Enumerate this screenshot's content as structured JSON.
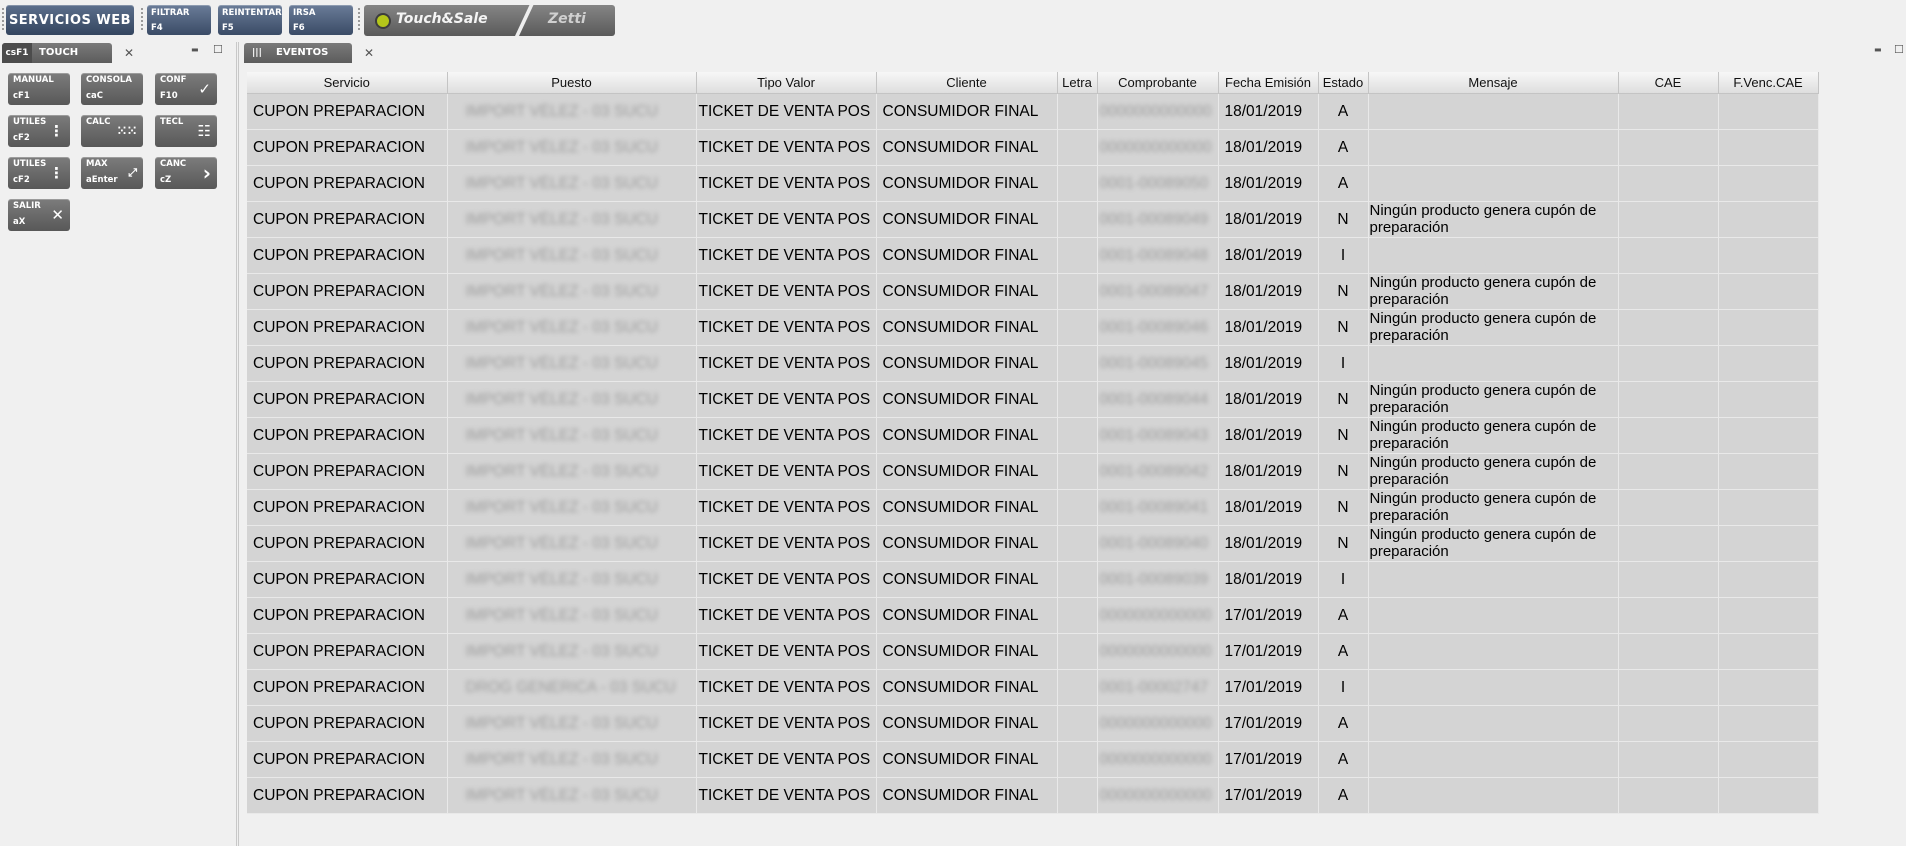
{
  "toolbar": {
    "main_label": "SERVICIOS WEB",
    "buttons": [
      {
        "label": "FILTRAR",
        "shortcut": "F4"
      },
      {
        "label": "REINTENTAR",
        "shortcut": "F5"
      },
      {
        "label": "IRSA",
        "shortcut": "F6"
      }
    ],
    "logo_primary": "Touch&Sale",
    "logo_secondary": "Zetti"
  },
  "left_panel": {
    "tab_prefix": "csF1",
    "tab_label": "TOUCH",
    "close_glyph": "✕",
    "minimize_glyph": "▬",
    "maximize_glyph": "☐",
    "tiles": [
      {
        "label": "MANUAL",
        "shortcut": "cF1",
        "icon": ""
      },
      {
        "label": "CONSOLA",
        "shortcut": "caC",
        "icon": ""
      },
      {
        "label": "CONF",
        "shortcut": "F10",
        "icon": "✓"
      },
      {
        "label": "UTILES",
        "shortcut": "cF2",
        "icon": "⋮"
      },
      {
        "label": "CALC",
        "shortcut": "",
        "icon": "⁙⁙"
      },
      {
        "label": "TECL",
        "shortcut": "",
        "icon": "☷"
      },
      {
        "label": "UTILES",
        "shortcut": "cF2",
        "icon": "⋮"
      },
      {
        "label": "MAX",
        "shortcut": "aEnter",
        "icon": "⤢"
      },
      {
        "label": "CANC",
        "shortcut": "cZ",
        "icon": "›"
      },
      {
        "label": "SALIR",
        "shortcut": "aX",
        "icon": "✕"
      }
    ]
  },
  "right_panel": {
    "tab_bars": "|||",
    "tab_label": "EVENTOS",
    "close_glyph": "✕",
    "minimize_glyph": "▬",
    "maximize_glyph": "☐",
    "columns": [
      "Servicio",
      "Puesto",
      "Tipo Valor",
      "Cliente",
      "Letra",
      "Comprobante",
      "Fecha Emisión",
      "Estado",
      "Mensaje",
      "CAE",
      "F.Venc.CAE"
    ],
    "rows": [
      {
        "servicio": "CUPON PREPARACION",
        "puesto": "IMPORT VÉLEZ - 03 SUCU",
        "tipo": "TICKET DE VENTA POS",
        "cliente": "CONSUMIDOR FINAL",
        "letra": "",
        "comprobante": "0000000000000",
        "fecha": "18/01/2019",
        "estado": "A",
        "mensaje": "",
        "cae": "",
        "fvenc": ""
      },
      {
        "servicio": "CUPON PREPARACION",
        "puesto": "IMPORT VÉLEZ - 03 SUCU",
        "tipo": "TICKET DE VENTA POS",
        "cliente": "CONSUMIDOR FINAL",
        "letra": "",
        "comprobante": "0000000000000",
        "fecha": "18/01/2019",
        "estado": "A",
        "mensaje": "",
        "cae": "",
        "fvenc": ""
      },
      {
        "servicio": "CUPON PREPARACION",
        "puesto": "IMPORT VÉLEZ - 03 SUCU",
        "tipo": "TICKET DE VENTA POS",
        "cliente": "CONSUMIDOR FINAL",
        "letra": "",
        "comprobante": "0001-00089050",
        "fecha": "18/01/2019",
        "estado": "A",
        "mensaje": "",
        "cae": "",
        "fvenc": ""
      },
      {
        "servicio": "CUPON PREPARACION",
        "puesto": "IMPORT VÉLEZ - 03 SUCU",
        "tipo": "TICKET DE VENTA POS",
        "cliente": "CONSUMIDOR FINAL",
        "letra": "",
        "comprobante": "0001-00089049",
        "fecha": "18/01/2019",
        "estado": "N",
        "mensaje": "Ningún producto genera cupón de preparación",
        "cae": "",
        "fvenc": ""
      },
      {
        "servicio": "CUPON PREPARACION",
        "puesto": "IMPORT VÉLEZ - 03 SUCU",
        "tipo": "TICKET DE VENTA POS",
        "cliente": "CONSUMIDOR FINAL",
        "letra": "",
        "comprobante": "0001-00089048",
        "fecha": "18/01/2019",
        "estado": "I",
        "mensaje": "",
        "cae": "",
        "fvenc": ""
      },
      {
        "servicio": "CUPON PREPARACION",
        "puesto": "IMPORT VÉLEZ - 03 SUCU",
        "tipo": "TICKET DE VENTA POS",
        "cliente": "CONSUMIDOR FINAL",
        "letra": "",
        "comprobante": "0001-00089047",
        "fecha": "18/01/2019",
        "estado": "N",
        "mensaje": "Ningún producto genera cupón de preparación",
        "cae": "",
        "fvenc": ""
      },
      {
        "servicio": "CUPON PREPARACION",
        "puesto": "IMPORT VÉLEZ - 03 SUCU",
        "tipo": "TICKET DE VENTA POS",
        "cliente": "CONSUMIDOR FINAL",
        "letra": "",
        "comprobante": "0001-00089046",
        "fecha": "18/01/2019",
        "estado": "N",
        "mensaje": "Ningún producto genera cupón de preparación",
        "cae": "",
        "fvenc": ""
      },
      {
        "servicio": "CUPON PREPARACION",
        "puesto": "IMPORT VÉLEZ - 03 SUCU",
        "tipo": "TICKET DE VENTA POS",
        "cliente": "CONSUMIDOR FINAL",
        "letra": "",
        "comprobante": "0001-00089045",
        "fecha": "18/01/2019",
        "estado": "I",
        "mensaje": "",
        "cae": "",
        "fvenc": ""
      },
      {
        "servicio": "CUPON PREPARACION",
        "puesto": "IMPORT VÉLEZ - 03 SUCU",
        "tipo": "TICKET DE VENTA POS",
        "cliente": "CONSUMIDOR FINAL",
        "letra": "",
        "comprobante": "0001-00089044",
        "fecha": "18/01/2019",
        "estado": "N",
        "mensaje": "Ningún producto genera cupón de preparación",
        "cae": "",
        "fvenc": ""
      },
      {
        "servicio": "CUPON PREPARACION",
        "puesto": "IMPORT VÉLEZ - 03 SUCU",
        "tipo": "TICKET DE VENTA POS",
        "cliente": "CONSUMIDOR FINAL",
        "letra": "",
        "comprobante": "0001-00089043",
        "fecha": "18/01/2019",
        "estado": "N",
        "mensaje": "Ningún producto genera cupón de preparación",
        "cae": "",
        "fvenc": ""
      },
      {
        "servicio": "CUPON PREPARACION",
        "puesto": "IMPORT VÉLEZ - 03 SUCU",
        "tipo": "TICKET DE VENTA POS",
        "cliente": "CONSUMIDOR FINAL",
        "letra": "",
        "comprobante": "0001-00089042",
        "fecha": "18/01/2019",
        "estado": "N",
        "mensaje": "Ningún producto genera cupón de preparación",
        "cae": "",
        "fvenc": ""
      },
      {
        "servicio": "CUPON PREPARACION",
        "puesto": "IMPORT VÉLEZ - 03 SUCU",
        "tipo": "TICKET DE VENTA POS",
        "cliente": "CONSUMIDOR FINAL",
        "letra": "",
        "comprobante": "0001-00089041",
        "fecha": "18/01/2019",
        "estado": "N",
        "mensaje": "Ningún producto genera cupón de preparación",
        "cae": "",
        "fvenc": ""
      },
      {
        "servicio": "CUPON PREPARACION",
        "puesto": "IMPORT VÉLEZ - 03 SUCU",
        "tipo": "TICKET DE VENTA POS",
        "cliente": "CONSUMIDOR FINAL",
        "letra": "",
        "comprobante": "0001-00089040",
        "fecha": "18/01/2019",
        "estado": "N",
        "mensaje": "Ningún producto genera cupón de preparación",
        "cae": "",
        "fvenc": ""
      },
      {
        "servicio": "CUPON PREPARACION",
        "puesto": "IMPORT VÉLEZ - 03 SUCU",
        "tipo": "TICKET DE VENTA POS",
        "cliente": "CONSUMIDOR FINAL",
        "letra": "",
        "comprobante": "0001-00089039",
        "fecha": "18/01/2019",
        "estado": "I",
        "mensaje": "",
        "cae": "",
        "fvenc": ""
      },
      {
        "servicio": "CUPON PREPARACION",
        "puesto": "IMPORT VÉLEZ - 03 SUCU",
        "tipo": "TICKET DE VENTA POS",
        "cliente": "CONSUMIDOR FINAL",
        "letra": "",
        "comprobante": "0000000000000",
        "fecha": "17/01/2019",
        "estado": "A",
        "mensaje": "",
        "cae": "",
        "fvenc": ""
      },
      {
        "servicio": "CUPON PREPARACION",
        "puesto": "IMPORT VÉLEZ - 03 SUCU",
        "tipo": "TICKET DE VENTA POS",
        "cliente": "CONSUMIDOR FINAL",
        "letra": "",
        "comprobante": "0000000000000",
        "fecha": "17/01/2019",
        "estado": "A",
        "mensaje": "",
        "cae": "",
        "fvenc": ""
      },
      {
        "servicio": "CUPON PREPARACION",
        "puesto": "DROG GENERICA - 03 SUCU",
        "tipo": "TICKET DE VENTA POS",
        "cliente": "CONSUMIDOR FINAL",
        "letra": "",
        "comprobante": "0001-00002747",
        "fecha": "17/01/2019",
        "estado": "I",
        "mensaje": "",
        "cae": "",
        "fvenc": ""
      },
      {
        "servicio": "CUPON PREPARACION",
        "puesto": "IMPORT VÉLEZ - 03 SUCU",
        "tipo": "TICKET DE VENTA POS",
        "cliente": "CONSUMIDOR FINAL",
        "letra": "",
        "comprobante": "0000000000000",
        "fecha": "17/01/2019",
        "estado": "A",
        "mensaje": "",
        "cae": "",
        "fvenc": ""
      },
      {
        "servicio": "CUPON PREPARACION",
        "puesto": "IMPORT VÉLEZ - 03 SUCU",
        "tipo": "TICKET DE VENTA POS",
        "cliente": "CONSUMIDOR FINAL",
        "letra": "",
        "comprobante": "0000000000000",
        "fecha": "17/01/2019",
        "estado": "A",
        "mensaje": "",
        "cae": "",
        "fvenc": ""
      },
      {
        "servicio": "CUPON PREPARACION",
        "puesto": "IMPORT VÉLEZ - 03 SUCU",
        "tipo": "TICKET DE VENTA POS",
        "cliente": "CONSUMIDOR FINAL",
        "letra": "",
        "comprobante": "0000000000000",
        "fecha": "17/01/2019",
        "estado": "A",
        "mensaje": "",
        "cae": "",
        "fvenc": ""
      }
    ]
  }
}
